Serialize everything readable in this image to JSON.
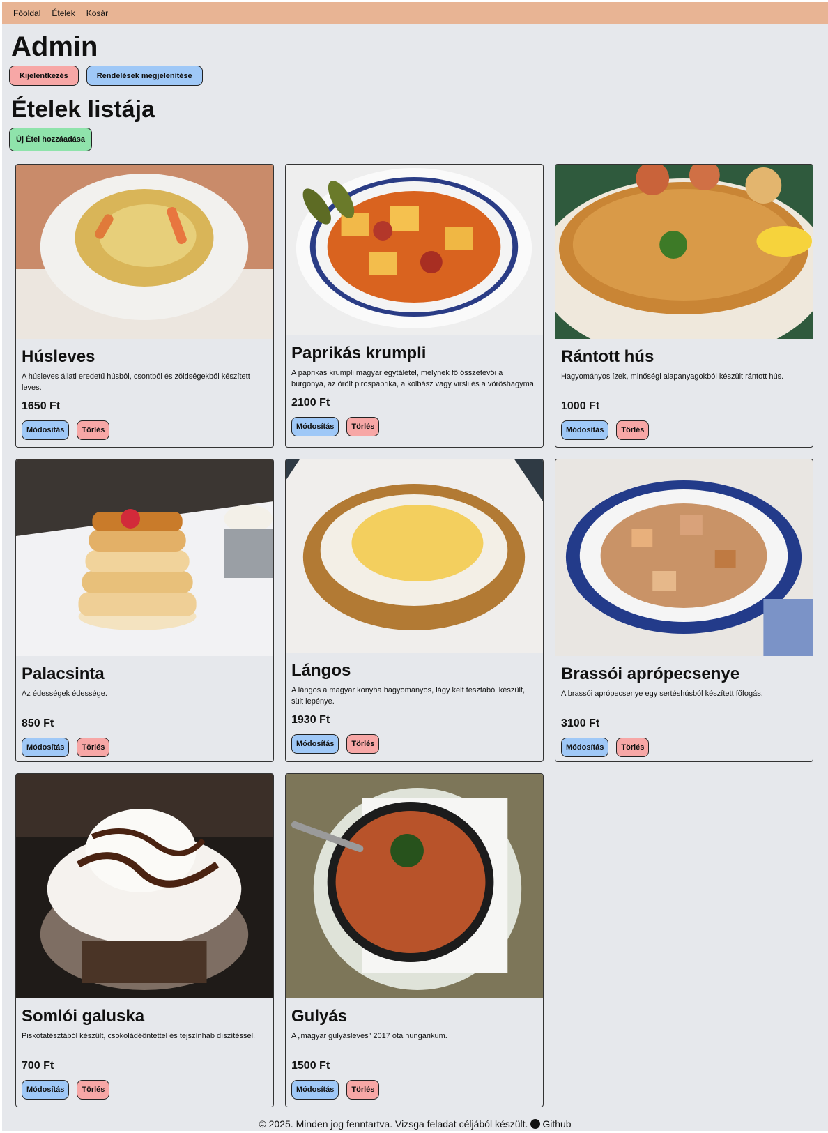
{
  "nav": {
    "items": [
      "Főoldal",
      "Ételek",
      "Kosár"
    ]
  },
  "header": {
    "title": "Admin",
    "logout_label": "Kijelentkezés",
    "orders_label": "Rendelések megjelenítése"
  },
  "section": {
    "title": "Ételek listája",
    "add_label": "Új Étel hozzáadása"
  },
  "labels": {
    "edit": "Módosítás",
    "delete": "Törlés"
  },
  "foods": [
    {
      "name": "Húsleves",
      "desc": "A húsleves állati eredetű húsból, csontból és zöldségekből készített leves.",
      "price": "1650 Ft",
      "color": "#c9a25a"
    },
    {
      "name": "Paprikás krumpli",
      "desc": "A paprikás krumpli magyar egytálétel, melynek fő összetevői a burgonya, az őrölt pirospaprika, a kolbász vagy virsli és a vöröshagyma.",
      "price": "2100 Ft",
      "color": "#e08a2c"
    },
    {
      "name": "Rántott hús",
      "desc": "Hagyományos ízek, minőségi alapanyagokból készült rántott hús.",
      "price": "1000 Ft",
      "color": "#d48a3a"
    },
    {
      "name": "Palacsinta",
      "desc": "Az édességek édessége.",
      "price": "850 Ft",
      "color": "#e2b26a"
    },
    {
      "name": "Lángos",
      "desc": "A lángos a magyar konyha hagyományos, lágy kelt tésztából készült, sült lepénye.",
      "price": "1930 Ft",
      "color": "#b98240"
    },
    {
      "name": "Brassói aprópecsenye",
      "desc": "A brassói aprópecsenye egy sertéshúsból készített főfogás.",
      "price": "3100 Ft",
      "color": "#a9774a"
    },
    {
      "name": "Somlói galuska",
      "desc": "Piskótatésztából készült, csokoládéöntettel és tejszínhab díszítéssel.",
      "price": "700 Ft",
      "color": "#6b3f22"
    },
    {
      "name": "Gulyás",
      "desc": "A „magyar gulyásleves” 2017 óta hungarikum.",
      "price": "1500 Ft",
      "color": "#a8451f"
    }
  ],
  "footer": {
    "copyright": "© 2025. Minden jog fenntartva.",
    "note": "Vizsga feladat céljából készült.",
    "github": "Github"
  }
}
